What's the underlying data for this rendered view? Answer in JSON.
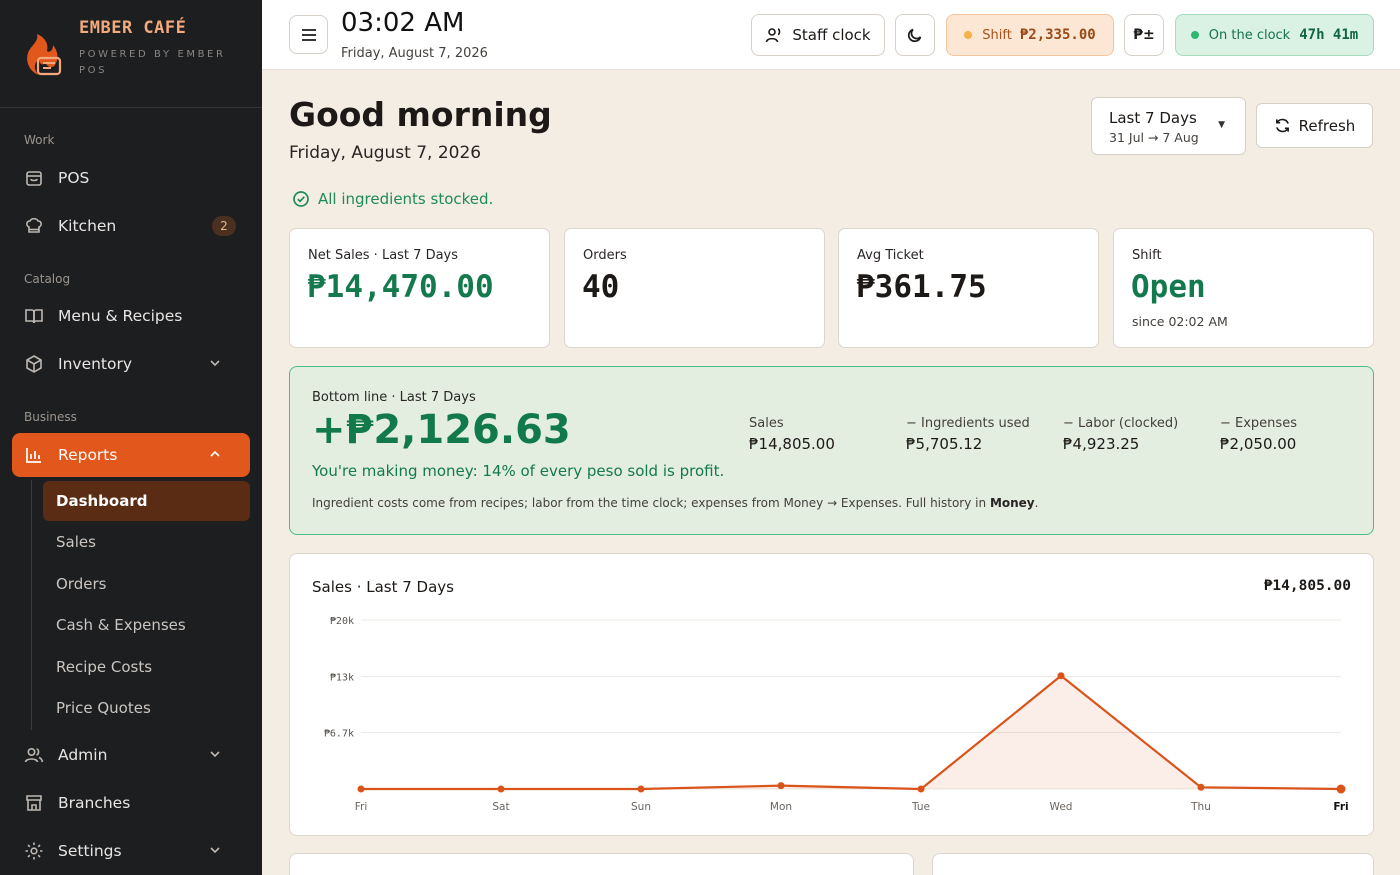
{
  "brand": {
    "name": "EMBER CAFÉ",
    "subtitle": "POWERED BY EMBER POS"
  },
  "sidebar": {
    "sections": {
      "work": "Work",
      "catalog": "Catalog",
      "business": "Business"
    },
    "items": {
      "pos": "POS",
      "kitchen": "Kitchen",
      "kitchen_badge": "2",
      "menu": "Menu & Recipes",
      "inventory": "Inventory",
      "reports": "Reports",
      "admin": "Admin",
      "branches": "Branches",
      "settings": "Settings"
    },
    "report_subitems": [
      "Dashboard",
      "Sales",
      "Orders",
      "Cash & Expenses",
      "Recipe Costs",
      "Price Quotes"
    ]
  },
  "topbar": {
    "time": "03:02 AM",
    "date": "Friday, August 7, 2026",
    "staff_clock": "Staff clock",
    "shift_label": "Shift",
    "shift_amount": "₱2,335.00",
    "currency_btn": "₱±",
    "clock_label": "On the clock",
    "clock_duration": "47h 41m"
  },
  "main": {
    "greeting": "Good morning",
    "date": "Friday, August 7, 2026",
    "stock_note": "All ingredients stocked.",
    "range": {
      "title": "Last 7 Days",
      "sub": "31 Jul → 7 Aug"
    },
    "refresh": "Refresh"
  },
  "kpis": [
    {
      "label": "Net Sales · Last 7 Days",
      "value": "₱14,470.00",
      "sub": ""
    },
    {
      "label": "Orders",
      "value": "40",
      "sub": ""
    },
    {
      "label": "Avg Ticket",
      "value": "₱361.75",
      "sub": ""
    },
    {
      "label": "Shift",
      "value": "Open",
      "sub": "since 02:02 AM"
    }
  ],
  "bottom_line": {
    "label": "Bottom line · Last 7 Days",
    "value": "+₱2,126.63",
    "note": "You're making money: 14% of every peso sold is profit.",
    "footer": "Ingredient costs come from recipes; labor from the time clock; expenses from Money → Expenses. Full history in",
    "footer_link": "Money",
    "stats": [
      {
        "label": "Sales",
        "value": "₱14,805.00"
      },
      {
        "label": "− Ingredients used",
        "value": "₱5,705.12"
      },
      {
        "label": "− Labor (clocked)",
        "value": "₱4,923.25"
      },
      {
        "label": "− Expenses",
        "value": "₱2,050.00"
      }
    ]
  },
  "chart_data": {
    "type": "area",
    "title": "Sales · Last 7 Days",
    "total": "₱14,805.00",
    "categories": [
      "Fri",
      "Sat",
      "Sun",
      "Mon",
      "Tue",
      "Wed",
      "Thu",
      "Fri"
    ],
    "values": [
      0,
      0,
      0,
      400,
      0,
      13400,
      200,
      0
    ],
    "y_ticks": [
      {
        "value": 20000,
        "label": "₱20k"
      },
      {
        "value": 13300,
        "label": "₱13k"
      },
      {
        "value": 6700,
        "label": "₱6.7k"
      }
    ],
    "ylim": [
      0,
      20000
    ],
    "color": "#d9541a",
    "grid": true
  },
  "colors": {
    "accent": "#e2571c",
    "positive": "#147a4e",
    "sidebar_bg": "#1d1e20"
  }
}
